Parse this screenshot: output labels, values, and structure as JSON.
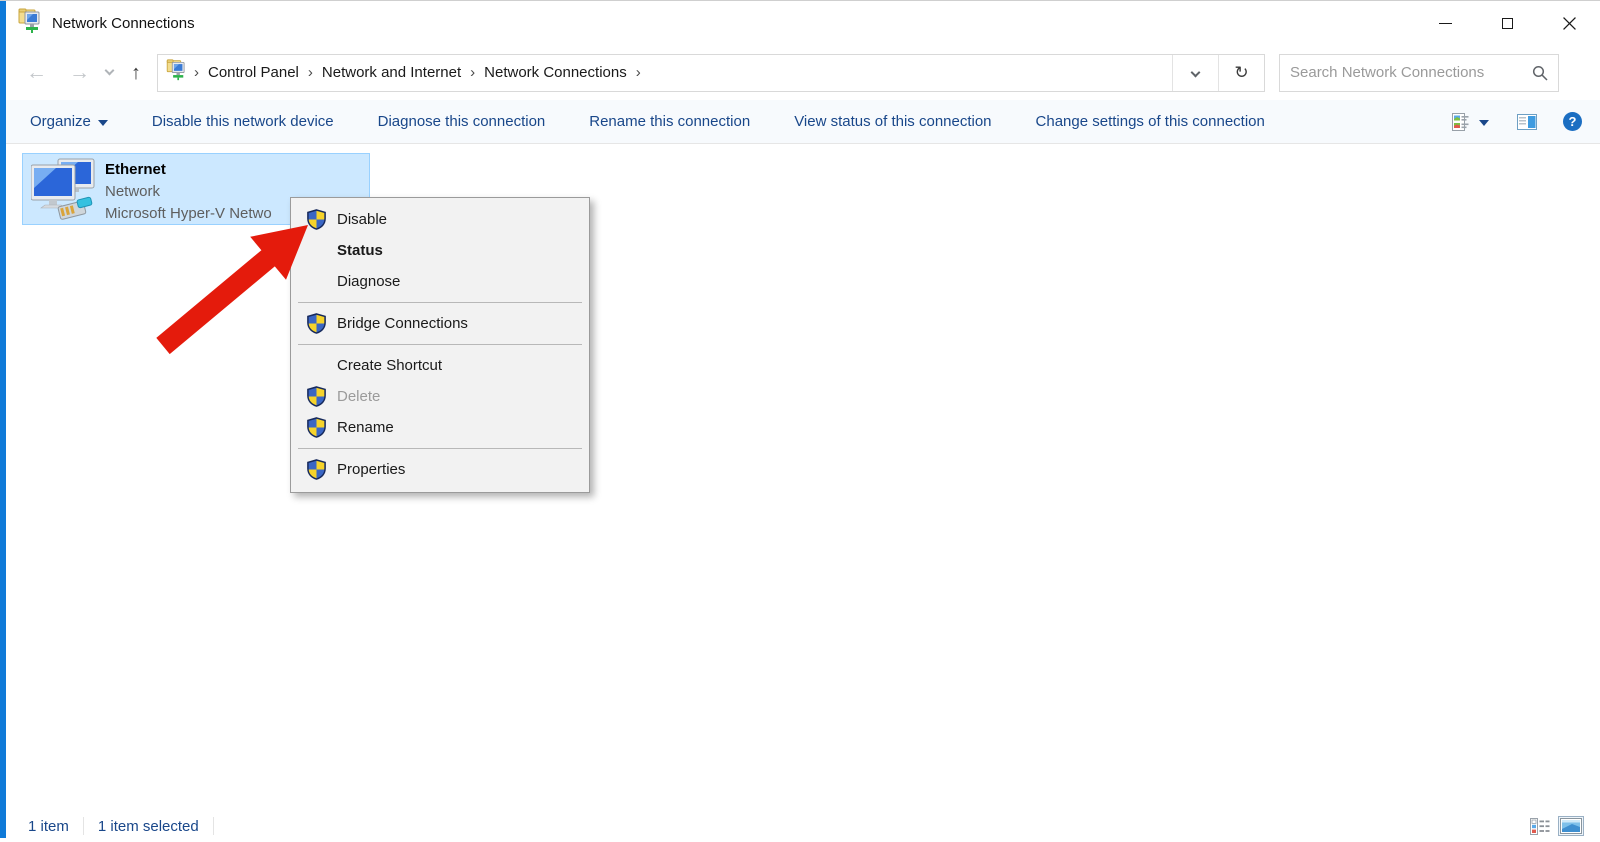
{
  "window": {
    "title": "Network Connections",
    "controls": [
      {
        "name": "minimize-button"
      },
      {
        "name": "maximize-button"
      },
      {
        "name": "close-button"
      }
    ]
  },
  "navigation": {
    "back": "back-arrow-icon",
    "forward": "forward-arrow-icon",
    "recent": "recent-locations-chevron-icon",
    "up": "up-arrow-icon",
    "breadcrumb": {
      "icon": "network-folder-icon",
      "separator": "›",
      "items": [
        "Control Panel",
        "Network and Internet",
        "Network Connections"
      ]
    },
    "address_dropdown": "chevron-down-icon",
    "refresh_glyph": "↻",
    "search": {
      "placeholder": "Search Network Connections",
      "value": "",
      "icon": "search-icon"
    }
  },
  "toolbar": {
    "items": [
      {
        "label": "Organize",
        "has_caret": true
      },
      {
        "label": "Disable this network device"
      },
      {
        "label": "Diagnose this connection"
      },
      {
        "label": "Rename this connection"
      },
      {
        "label": "View status of this connection"
      },
      {
        "label": "Change settings of this connection"
      }
    ],
    "right_icons": [
      "views-icon",
      "views-dropdown-caret-icon",
      "preview-pane-icon",
      "help-icon"
    ],
    "help_glyph": "?"
  },
  "main": {
    "connection": {
      "name": "Ethernet",
      "network": "Network",
      "device": "Microsoft Hyper-V Netwo",
      "icon": "ethernet-adapter-icon",
      "selected": true
    }
  },
  "context_menu": {
    "items": [
      {
        "type": "item",
        "label": "Disable",
        "shield": true
      },
      {
        "type": "item",
        "label": "Status",
        "shield": false,
        "bold": true
      },
      {
        "type": "item",
        "label": "Diagnose",
        "shield": false
      },
      {
        "type": "separator"
      },
      {
        "type": "item",
        "label": "Bridge Connections",
        "shield": true
      },
      {
        "type": "separator"
      },
      {
        "type": "item",
        "label": "Create Shortcut",
        "shield": false
      },
      {
        "type": "item",
        "label": "Delete",
        "shield": true,
        "disabled": true
      },
      {
        "type": "item",
        "label": "Rename",
        "shield": true
      },
      {
        "type": "separator"
      },
      {
        "type": "item",
        "label": "Properties",
        "shield": true
      }
    ]
  },
  "annotation": {
    "type": "red-arrow",
    "points_at": "Disable"
  },
  "status_bar": {
    "items_count": "1 item",
    "selection": "1 item selected",
    "right_icons": [
      "details-view-icon",
      "large-icons-view-icon"
    ]
  },
  "colors": {
    "accent_border": "#0F7AD8",
    "selection_bg": "#CCE8FF",
    "selection_border": "#99D1FF",
    "toolbar_text": "#19478A",
    "menu_bg": "#F2F2F2",
    "disabled_text": "#9B9B9B",
    "arrow_red": "#E41B0C",
    "shield_blue": "#3A66C4",
    "shield_yellow": "#F6D32B",
    "help_blue": "#1B6EC2"
  }
}
